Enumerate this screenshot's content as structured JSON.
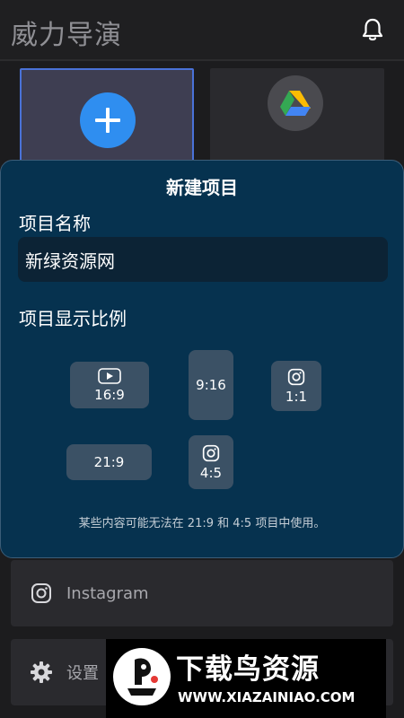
{
  "app": {
    "title": "威力导演"
  },
  "icons": {
    "notification": "bell-icon",
    "new_project": "plus-icon",
    "drive": "google-drive-icon",
    "instagram": "instagram-icon",
    "settings": "gear-icon",
    "youtube": "youtube-icon"
  },
  "colors": {
    "accent_blue": "#2f8ef0",
    "dialog_bg": "#06324f",
    "ratio_button_bg": "#3b5165",
    "input_bg": "#0c2335"
  },
  "dialog": {
    "title": "新建项目",
    "project_name_label": "项目名称",
    "project_name_value": "新绿资源网",
    "aspect_ratio_label": "项目显示比例",
    "ratios": {
      "r16_9": "16:9",
      "r9_16": "9:16",
      "r1_1": "1:1",
      "r21_9": "21:9",
      "r4_5": "4:5"
    },
    "note": "某些内容可能无法在 21:9 和 4:5 项目中使用。"
  },
  "menu": {
    "instagram_label": "Instagram",
    "settings_label": "设置"
  },
  "watermark": {
    "title": "下载鸟资源",
    "url": "WWW.XIAZAINIAO.COM"
  }
}
